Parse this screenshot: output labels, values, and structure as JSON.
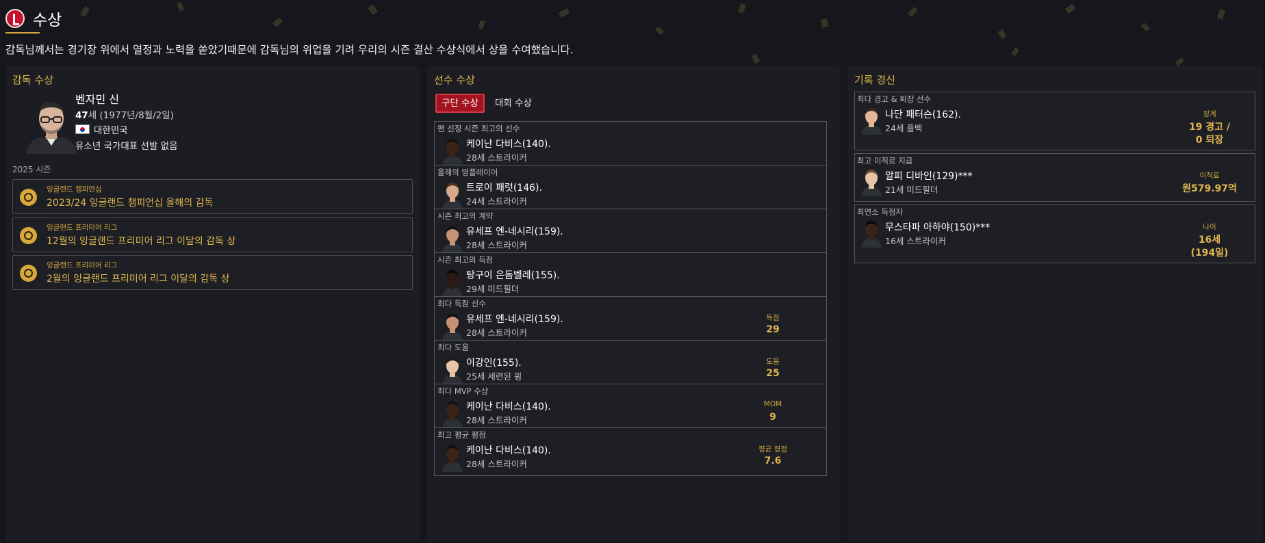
{
  "page": {
    "title": "수상",
    "intro": "감독님께서는 경기장 위에서 열정과 노력을 쏟았기때문에 감독님의 위업을 기려 우리의 시즌 결산 수상식에서 상을 수여했습니다."
  },
  "colors": {
    "accent": "#e0b650",
    "tab_active": "#a31420",
    "background": "#15171c",
    "panel": "#1b1d22"
  },
  "manager_panel": {
    "title": "감독 수상",
    "manager": {
      "name": "벤자민 신",
      "age": "47",
      "age_suffix": "세 (1977년/8월/2일)",
      "nation": "대한민국",
      "youth": "유소년 국가대표 선발 없음"
    },
    "season_label": "2025 시즌",
    "awards": [
      {
        "competition": "잉글랜드 챔피언십",
        "name": "2023/24 잉글랜드 챔피언십 올해의 감독"
      },
      {
        "competition": "잉글랜드 프리미어 리그",
        "name": "12월의 잉글랜드 프리미어 리그 이달의 감독 상"
      },
      {
        "competition": "잉글랜드 프리미어 리그",
        "name": "2월의 잉글랜드 프리미어 리그 이달의 감독 상"
      }
    ]
  },
  "player_panel": {
    "title": "선수 수상",
    "tabs": [
      {
        "label": "구단 수상"
      },
      {
        "label": "대회 수상"
      }
    ],
    "awards": [
      {
        "heading": "팬 선정 시즌 최고의 선수",
        "player": "케이난 다비스(140).",
        "info": "28세 스트라이커",
        "stat_label": "",
        "stat_value": ""
      },
      {
        "heading": "올해의 영플레이어",
        "player": "트로이 패럿(146).",
        "info": "24세 스트라이커",
        "stat_label": "",
        "stat_value": ""
      },
      {
        "heading": "시즌 최고의 계약",
        "player": "유세프 엔-네시리(159).",
        "info": "28세 스트라이커",
        "stat_label": "",
        "stat_value": ""
      },
      {
        "heading": "시즌 최고의 득점",
        "player": "탕구이 은돔벨레(155).",
        "info": "29세 미드필더",
        "stat_label": "",
        "stat_value": ""
      },
      {
        "heading": "최다 득점 선수",
        "player": "유세프 엔-네시리(159).",
        "info": "28세 스트라이커",
        "stat_label": "득점",
        "stat_value": "29"
      },
      {
        "heading": "최다 도움",
        "player": "이강인(155).",
        "info": "25세 세련된 윙",
        "stat_label": "도움",
        "stat_value": "25"
      },
      {
        "heading": "최다 MVP 수상",
        "player": "케이난 다비스(140).",
        "info": "28세 스트라이커",
        "stat_label": "MOM",
        "stat_value": "9"
      },
      {
        "heading": "최고 평균 평점",
        "player": "케이난 다비스(140).",
        "info": "28세 스트라이커",
        "stat_label": "평균 평점",
        "stat_value": "7.6"
      }
    ]
  },
  "records_panel": {
    "title": "기록 경신",
    "records": [
      {
        "heading": "최다 경고 & 퇴장 선수",
        "player": "나단 패터슨(162).",
        "info": "24세 풀백",
        "stat_label": "징계",
        "stat_line1": "19 경고 /",
        "stat_line2": "0 퇴장"
      },
      {
        "heading": "최고 이적료 지급",
        "player": "알피 디바인(129)***",
        "info": "21세 미드필더",
        "stat_label": "이적료",
        "stat_line1": "원579.97억",
        "stat_line2": ""
      },
      {
        "heading": "최연소 득점자",
        "player": "무스타파 아하야(150)***",
        "info": "16세 스트라이커",
        "stat_label": "나이",
        "stat_line1": "16세",
        "stat_line2": "(194일)"
      }
    ]
  }
}
